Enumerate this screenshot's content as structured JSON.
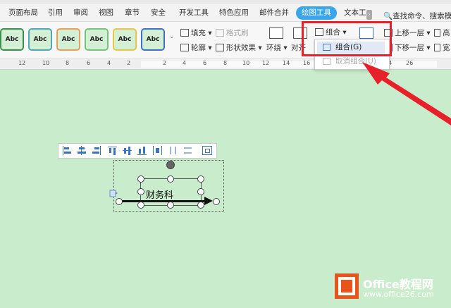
{
  "tabs": [
    "页面布局",
    "引用",
    "审阅",
    "视图",
    "章节",
    "安全",
    "开发工具",
    "特色应用",
    "邮件合并",
    "绘图工具",
    "文本工"
  ],
  "active_tab": "绘图工具",
  "search_text": "查找命令、搜索模板",
  "style_gallery": [
    "Abc",
    "Abc",
    "Abc",
    "Abc",
    "Abc",
    "Abc"
  ],
  "ribbon": {
    "fill": "填充",
    "format_brush": "格式刷",
    "outline": "轮廓",
    "shape_effect": "形状效果",
    "wrap": "环绕",
    "align": "对齐",
    "group": "组合",
    "bring_forward": "上移一层",
    "send_backward": "下移一层",
    "height_short": "高",
    "width_short": "宽"
  },
  "ruler_numbers": [
    "12",
    "10",
    "8",
    "6",
    "4",
    "2",
    "2",
    "4",
    "6",
    "8",
    "10",
    "12",
    "14",
    "16",
    "18",
    "20",
    "22",
    "24",
    "26"
  ],
  "dropdown": {
    "group_item": "组合(G)",
    "ungroup_item": "取消组合(U)"
  },
  "shape_text": "财务科",
  "logo": {
    "name": "Office教程网",
    "url": "www.office26.com"
  },
  "colors": {
    "accent_tab": "#3aa5e8",
    "highlight": "#e8202a",
    "page_background": "#c9eccc"
  }
}
